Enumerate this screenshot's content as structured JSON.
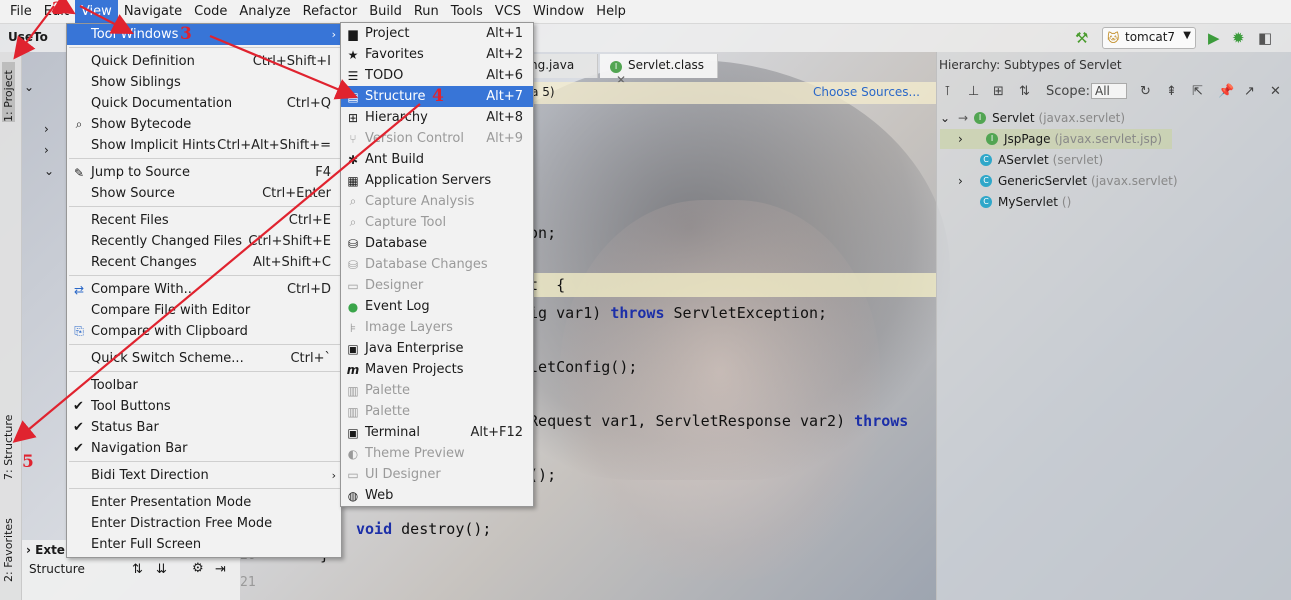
{
  "menubar": [
    "File",
    "Edit",
    "View",
    "Navigate",
    "Code",
    "Analyze",
    "Refactor",
    "Build",
    "Run",
    "Tools",
    "VCS",
    "Window",
    "Help"
  ],
  "breadcrumb": "UseTo",
  "run_config": "tomcat7",
  "project_tab": "1: Project",
  "structure_tab": "7: Structure",
  "favorites_tab": "2: Favorites",
  "editor_tabs": [
    "ng.java",
    "Servlet.class"
  ],
  "banner_link": "Choose Sources...",
  "banner_text": "va 5)",
  "code_lines": [
    {
      "text": "ion;"
    },
    {
      "text": "et  {"
    },
    {
      "text": "fig var1) ",
      "kw": "throws",
      "rest": " ServletException;"
    },
    {
      "text": "vletConfig();"
    },
    {
      "text": "tRequest var1, ServletResponse var2) ",
      "kw": "throws",
      "rest": ""
    },
    {
      "text": "o();"
    },
    {
      "kw": "void",
      "rest": " destroy();"
    },
    {
      "text": "}"
    }
  ],
  "gutter": [
    "20",
    "21"
  ],
  "hierarchy": {
    "title": "Hierarchy:  Subtypes of Servlet",
    "scope_label": "Scope:",
    "scope_value": "All",
    "rows": [
      {
        "name": "Servlet",
        "pkg": "(javax.servlet)"
      },
      {
        "name": "JspPage",
        "pkg": "(javax.servlet.jsp)"
      },
      {
        "name": "AServlet",
        "pkg": "(servlet)"
      },
      {
        "name": "GenericServlet",
        "pkg": "(javax.servlet)"
      },
      {
        "name": "MyServlet",
        "pkg": "()"
      }
    ]
  },
  "structure_panel": {
    "title": "Structure",
    "external": "External Libraries"
  },
  "view_menu": [
    {
      "label": "Tool Windows",
      "submenu": true
    },
    {
      "label": "Quick Definition",
      "key": "Ctrl+Shift+I"
    },
    {
      "label": "Show Siblings"
    },
    {
      "label": "Quick Documentation",
      "key": "Ctrl+Q"
    },
    {
      "label": "Show Bytecode"
    },
    {
      "label": "Show Implicit Hints",
      "key": "Ctrl+Alt+Shift+="
    },
    {
      "label": "Jump to Source",
      "key": "F4"
    },
    {
      "label": "Show Source",
      "key": "Ctrl+Enter"
    },
    {
      "label": "Recent Files",
      "key": "Ctrl+E"
    },
    {
      "label": "Recently Changed Files",
      "key": "Ctrl+Shift+E"
    },
    {
      "label": "Recent Changes",
      "key": "Alt+Shift+C"
    },
    {
      "label": "Compare With...",
      "key": "Ctrl+D"
    },
    {
      "label": "Compare File with Editor"
    },
    {
      "label": "Compare with Clipboard"
    },
    {
      "label": "Quick Switch Scheme...",
      "key": "Ctrl+`"
    },
    {
      "label": "Toolbar"
    },
    {
      "label": "Tool Buttons"
    },
    {
      "label": "Status Bar"
    },
    {
      "label": "Navigation Bar"
    },
    {
      "label": "Bidi Text Direction"
    },
    {
      "label": "Enter Presentation Mode"
    },
    {
      "label": "Enter Distraction Free Mode"
    },
    {
      "label": "Enter Full Screen"
    }
  ],
  "tool_windows_menu": [
    {
      "label": "Project",
      "key": "Alt+1"
    },
    {
      "label": "Favorites",
      "key": "Alt+2"
    },
    {
      "label": "TODO",
      "key": "Alt+6"
    },
    {
      "label": "Structure",
      "key": "Alt+7"
    },
    {
      "label": "Hierarchy",
      "key": "Alt+8"
    },
    {
      "label": "Version Control",
      "key": "Alt+9"
    },
    {
      "label": "Ant Build"
    },
    {
      "label": "Application Servers"
    },
    {
      "label": "Capture Analysis"
    },
    {
      "label": "Capture Tool"
    },
    {
      "label": "Database"
    },
    {
      "label": "Database Changes"
    },
    {
      "label": "Designer"
    },
    {
      "label": "Event Log"
    },
    {
      "label": "Image Layers"
    },
    {
      "label": "Java Enterprise"
    },
    {
      "label": "Maven Projects"
    },
    {
      "label": "Palette"
    },
    {
      "label": "Palette"
    },
    {
      "label": "Terminal",
      "key": "Alt+F12"
    },
    {
      "label": "Theme Preview"
    },
    {
      "label": "UI Designer"
    },
    {
      "label": "Web"
    }
  ],
  "annotations": [
    "2",
    "3",
    "4",
    "5"
  ],
  "colors": {
    "selection": "#3875d7",
    "annotation": "#e0232f"
  }
}
